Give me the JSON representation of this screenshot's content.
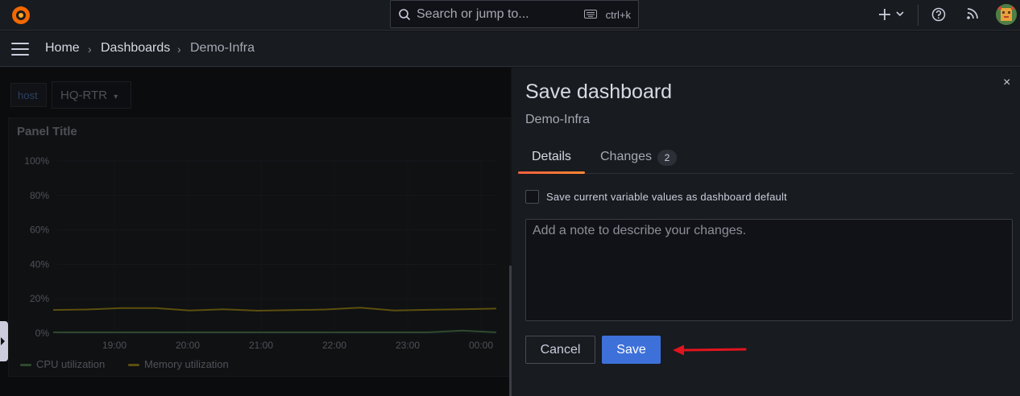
{
  "topbar": {
    "search_placeholder": "Search or jump to...",
    "search_shortcut": "ctrl+k",
    "icons": [
      "grafana-logo-icon",
      "search-icon",
      "keyboard-icon",
      "plus-icon",
      "chevron-down-icon",
      "help-icon",
      "rss-icon",
      "avatar"
    ]
  },
  "breadcrumb": {
    "items": [
      "Home",
      "Dashboards",
      "Demo-Infra"
    ],
    "separator": "›"
  },
  "dashboard": {
    "variable_label": "host",
    "variable_value": "HQ-RTR",
    "panel_title": "Panel Title",
    "legend": [
      {
        "name": "CPU utilization",
        "color": "#73bf69"
      },
      {
        "name": "Memory utilization",
        "color": "#f2cc0c"
      }
    ]
  },
  "chart_data": {
    "type": "line",
    "y_ticks": [
      "100%",
      "80%",
      "60%",
      "40%",
      "20%",
      "0%"
    ],
    "x_ticks": [
      "19:00",
      "20:00",
      "21:00",
      "22:00",
      "23:00",
      "00:00"
    ],
    "ylim": [
      0,
      100
    ],
    "series": [
      {
        "name": "CPU utilization",
        "color": "#73bf69",
        "values": [
          0.5,
          0.5,
          0.5,
          0.5,
          0.5,
          0.5,
          0.5,
          0.5,
          0.5,
          0.5,
          0.5,
          0.5,
          1.5,
          0.5
        ]
      },
      {
        "name": "Memory utilization",
        "color": "#f2cc0c",
        "values": [
          13.5,
          13.8,
          14.6,
          14.6,
          13.2,
          13.9,
          13.1,
          13.4,
          13.8,
          14.8,
          13.2,
          13.6,
          13.9,
          14.3
        ]
      }
    ]
  },
  "drawer": {
    "title": "Save dashboard",
    "subtitle": "Demo-Infra",
    "close_label": "×",
    "tabs": [
      {
        "label": "Details",
        "active": true
      },
      {
        "label": "Changes",
        "count": "2"
      }
    ],
    "checkbox_label": "Save current variable values as dashboard default",
    "note_placeholder": "Add a note to describe your changes.",
    "cancel_label": "Cancel",
    "save_label": "Save"
  },
  "colors": {
    "accent_blue": "#3d71d9",
    "tab_active": "#f55f3e",
    "annotation_arrow": "#e0141e"
  }
}
